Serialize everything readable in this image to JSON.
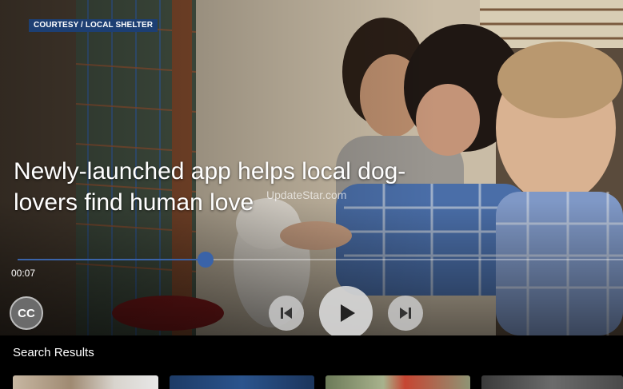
{
  "video": {
    "credit": "COURTESY / LOCAL SHELTER",
    "headline": "Newly-launched app helps local dog-lovers find human love",
    "watermark": "UpdateStar.com",
    "progress_fraction": 0.31,
    "elapsed_time": "00:07"
  },
  "controls": {
    "cc_label": "CC",
    "prev_icon": "skip-previous-icon",
    "play_icon": "play-icon",
    "next_icon": "skip-next-icon",
    "accent_color": "#3a63a8"
  },
  "search_results": {
    "title": "Search Results",
    "items": [
      {
        "thumbnail": "result-1"
      },
      {
        "thumbnail": "result-2"
      },
      {
        "thumbnail": "result-3"
      },
      {
        "thumbnail": "result-4"
      }
    ]
  }
}
